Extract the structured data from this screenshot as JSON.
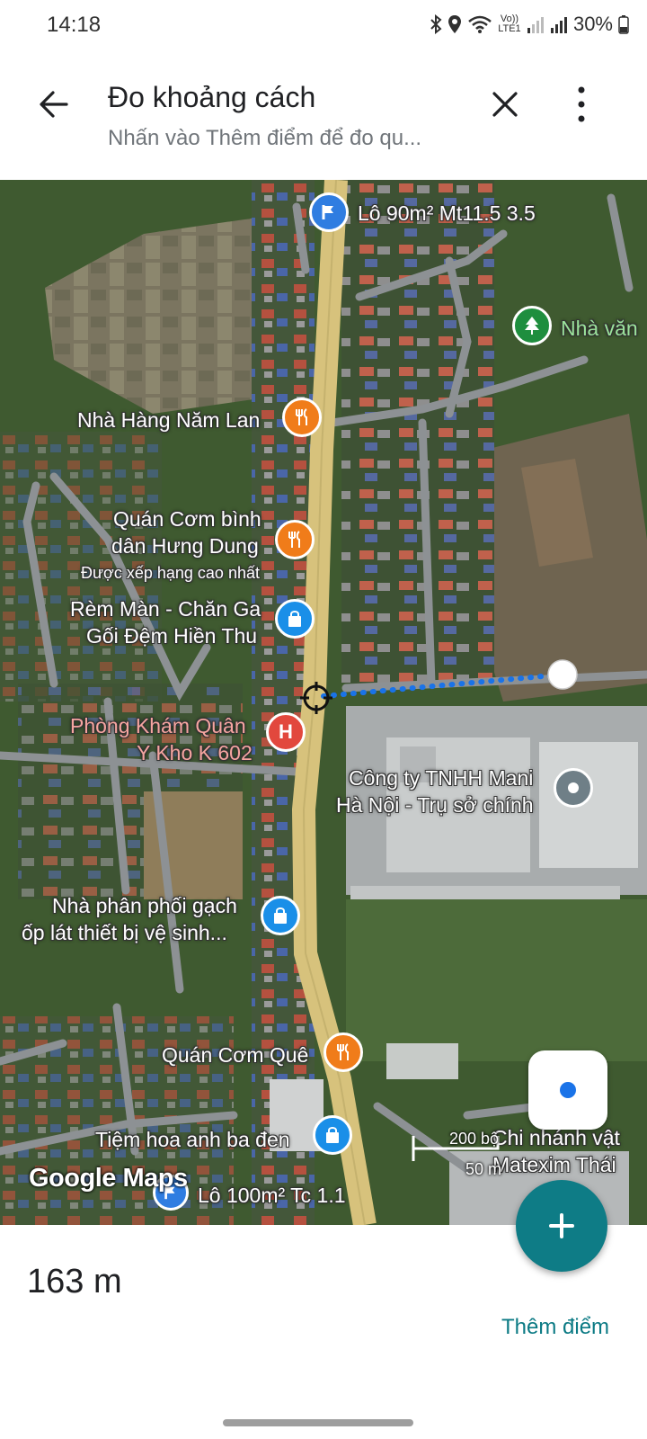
{
  "status_bar": {
    "time": "14:18",
    "network_label": "Vo)) LTE1",
    "battery": "30%"
  },
  "app_bar": {
    "title": "Đo khoảng cách",
    "subtitle": "Nhấn vào Thêm điểm để đo qu...",
    "back_icon": "arrow-back-icon",
    "close_icon": "close-icon",
    "more_icon": "more-vert-icon"
  },
  "map": {
    "pois": {
      "lot_90": "Lô 90m² Mt11.5 3.5",
      "nha_van": "Nhà văn",
      "nha_hang_nam_lan": "Nhà Hàng Năm Lan",
      "quan_com_line1": "Quán Cơm bình",
      "quan_com_line2": "dân Hưng Dung",
      "quan_com_rating": "Được xếp hạng cao nhất",
      "rem_man_line1": "Rèm Màn - Chăn Ga",
      "rem_man_line2": "Gối Đệm Hiền Thu",
      "phong_kham_line1": "Phòng Khám Quân",
      "phong_kham_line2": "Y Kho K 602",
      "cong_ty_line1": "Công ty TNHH Mani",
      "cong_ty_line2": "Hà Nội - Trụ sở chính",
      "nha_phan_phoi_line1": "Nhà phân phối gạch",
      "nha_phan_phoi_line2": "ốp lát thiết bị vệ sinh...",
      "quan_com_que": "Quán Cơm Quê",
      "tiem_hoa": "Tiệm hoa anh ba đen",
      "chi_nhanh_line1": "Chi nhánh vật",
      "chi_nhanh_line2": "Matexim Thái",
      "lot_100": "Lô 100m² Tc 1.1"
    },
    "attribution": "Google Maps",
    "scale_imperial": "200 bộ",
    "scale_metric": "50 m",
    "locate_icon": "my-location-icon",
    "crosshair_icon": "crosshair-icon"
  },
  "bottom": {
    "distance": "163 m",
    "add_point": "Thêm điểm",
    "fab_icon": "plus-icon"
  },
  "colors": {
    "fab": "#0e7c86",
    "link": "#0b7a84",
    "restaurant_pin": "#f07c1a",
    "shop_pin": "#1a8fe8",
    "hospital_pin": "#e2483d",
    "park_pin": "#1e8e3e",
    "measure_line": "#1a73e8",
    "road": "#d9c27a"
  }
}
